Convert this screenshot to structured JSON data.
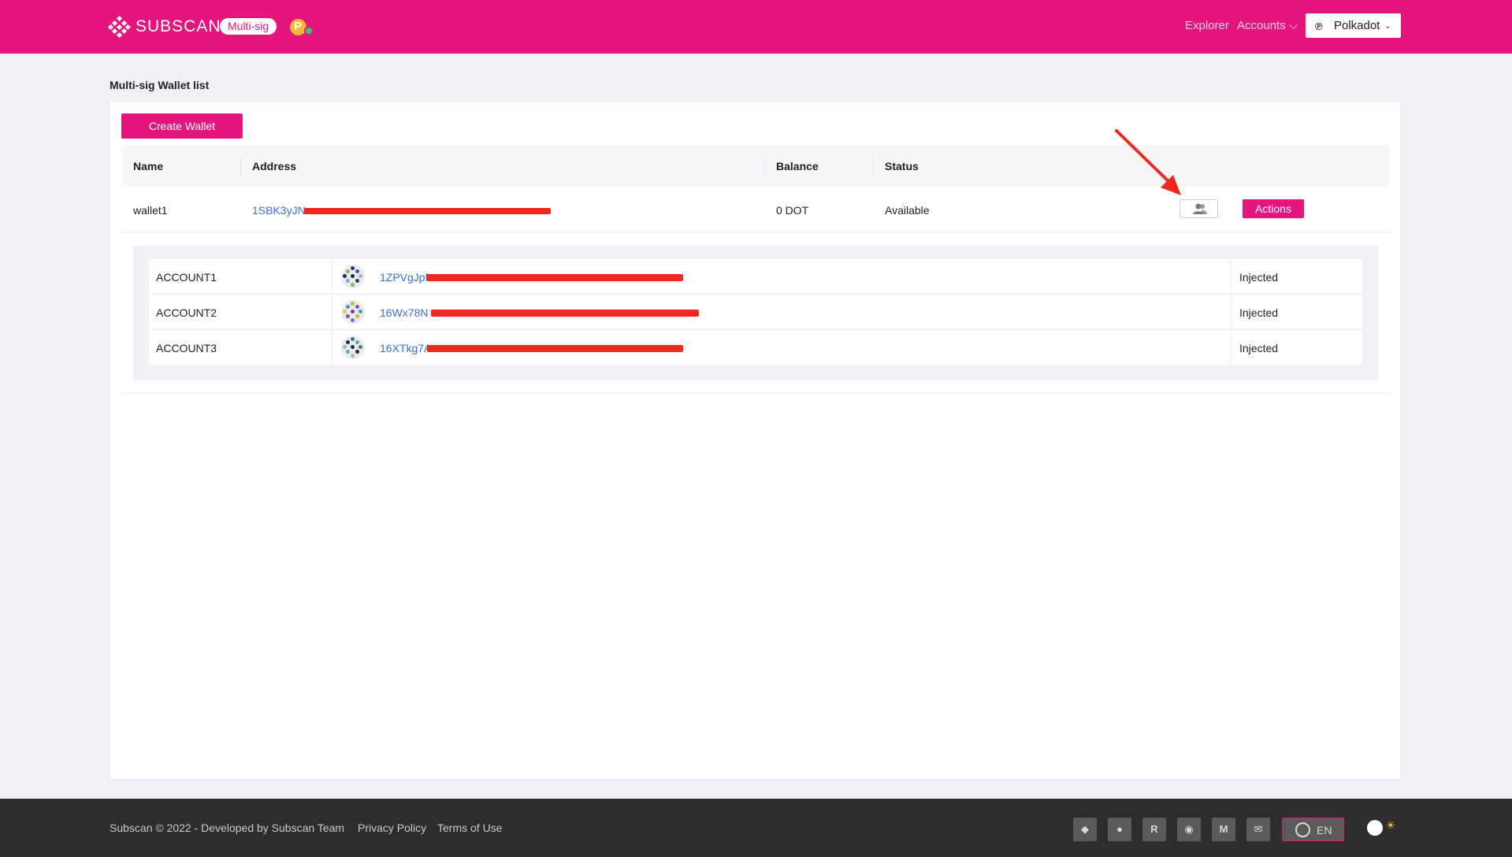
{
  "header": {
    "logo_text": "SUBSCAN",
    "badge": "Multi-sig",
    "nav_explorer": "Explorer",
    "nav_accounts": "Accounts",
    "network": "Polkadot"
  },
  "page": {
    "title": "Multi-sig Wallet list",
    "create_button": "Create Wallet"
  },
  "table": {
    "columns": [
      "Name",
      "Address",
      "Balance",
      "Status"
    ],
    "rows": [
      {
        "name": "wallet1",
        "address": "1SBK3yJN",
        "balance": "0 DOT",
        "status": "Available",
        "actions_label": "Actions"
      }
    ]
  },
  "members": [
    {
      "name": "ACCOUNT1",
      "address": "1ZPVgJpf",
      "source": "Injected"
    },
    {
      "name": "ACCOUNT2",
      "address": "16Wx78N",
      "source": "Injected"
    },
    {
      "name": "ACCOUNT3",
      "address": "16XTkg7A",
      "source": "Injected"
    }
  ],
  "footer": {
    "copyright": "Subscan © 2022 - Developed by Subscan Team",
    "privacy": "Privacy Policy",
    "terms": "Terms of Use",
    "language": "EN",
    "socials": [
      "element-icon",
      "twitter-icon",
      "riot-icon",
      "github-icon",
      "medium-icon",
      "email-icon"
    ]
  },
  "colors": {
    "brand": "#e4167d",
    "link": "#3b6fd6",
    "redaction": "#f0281e"
  }
}
